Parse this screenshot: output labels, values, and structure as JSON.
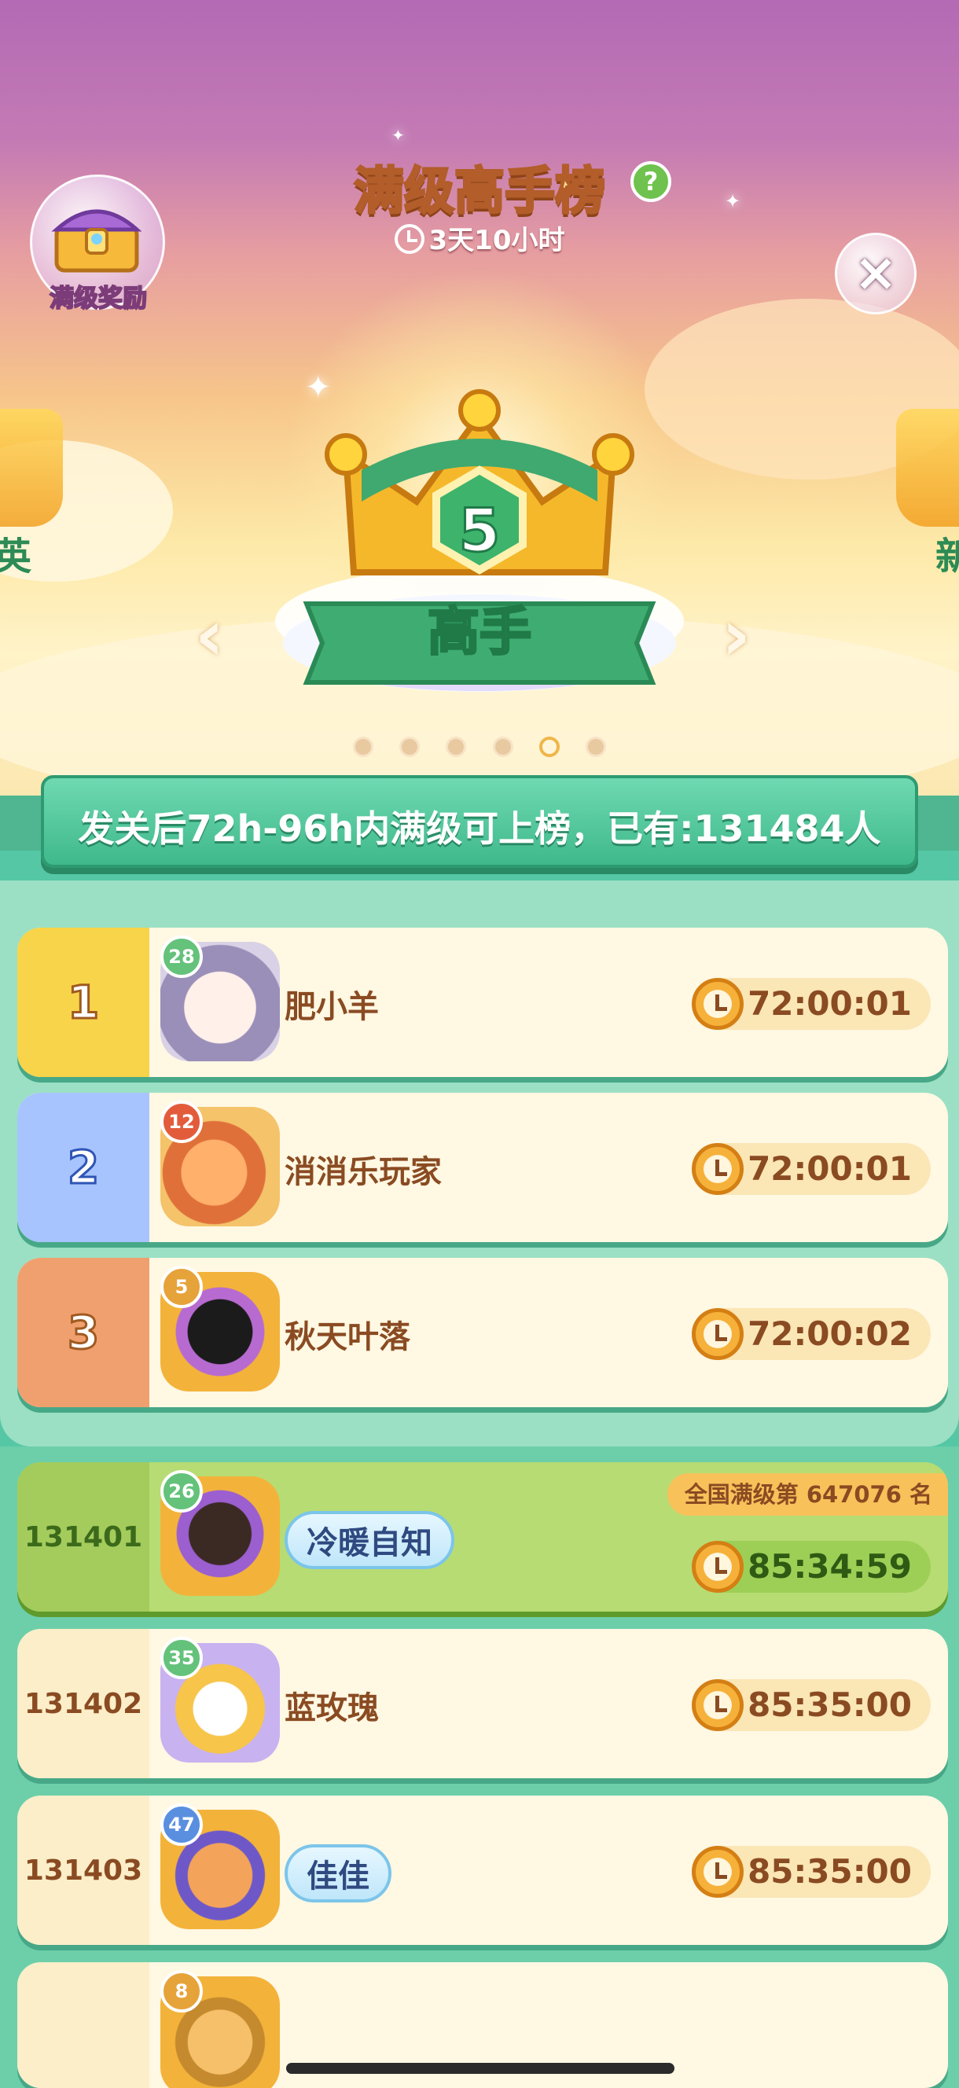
{
  "header": {
    "title": "满级高手榜",
    "help": "?",
    "countdown": "3天10小时",
    "reward_label": "满级奖励",
    "close": "×"
  },
  "carousel": {
    "tier_number": "5",
    "tier_name": "高手",
    "left_peek_text": "英",
    "right_peek_text": "新",
    "prev": "‹",
    "next": "›",
    "page_count": 6,
    "active_page": 5
  },
  "banner": {
    "text": "发关后72h-96h内满级可上榜，已有:131484人"
  },
  "colors": {
    "gold": "#f8d44a",
    "silver": "#a7c4ff",
    "bronze": "#f0a06e",
    "me_row": "#b7dc73",
    "normal_rank": "#fbeec8"
  },
  "rows": [
    {
      "rank": "1",
      "level": "28",
      "name": "肥小羊",
      "time": "72:00:01"
    },
    {
      "rank": "2",
      "level": "12",
      "name": "消消乐玩家",
      "time": "72:00:01"
    },
    {
      "rank": "3",
      "level": "5",
      "name": "秋天叶落",
      "time": "72:00:02"
    },
    {
      "rank": "131401",
      "level": "26",
      "name": "冷暖自知",
      "time": "85:34:59",
      "badge": "全国满级第 647076 名"
    },
    {
      "rank": "131402",
      "level": "35",
      "name": "蓝玫瑰",
      "time": "85:35:00"
    },
    {
      "rank": "131403",
      "level": "47",
      "name": "佳佳",
      "time": "85:35:00"
    },
    {
      "rank": "",
      "level": "8",
      "name": "",
      "time": ""
    }
  ]
}
